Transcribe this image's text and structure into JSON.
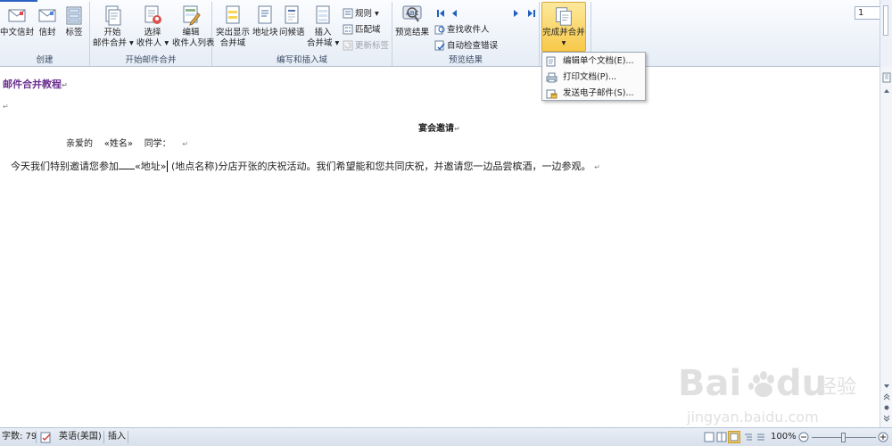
{
  "ribbon": {
    "groups": {
      "create": {
        "label": "创建",
        "buttons": [
          "中文信封",
          "信封",
          "标签"
        ]
      },
      "start_merge": {
        "label": "开始邮件合并",
        "start_line1": "开始",
        "start_line2": "邮件合并",
        "select_line1": "选择",
        "select_line2": "收件人",
        "edit_line1": "编辑",
        "edit_line2": "收件人列表"
      },
      "write_insert": {
        "label": "编写和插入域",
        "highlight_line1": "突出显示",
        "highlight_line2": "合并域",
        "address_block": "地址块",
        "greeting": "问候语",
        "insert_line1": "插入",
        "insert_line2": "合并域",
        "rules": "规则",
        "match_fields": "匹配域",
        "update_labels": "更新标签"
      },
      "preview": {
        "label": "预览结果",
        "preview_results": "预览结果",
        "record": "1",
        "find_recipient": "查找收件人",
        "auto_check": "自动检查错误"
      },
      "finish": {
        "label": "完成并合并"
      }
    }
  },
  "dropdown": {
    "items": [
      "编辑单个文档(E)...",
      "打印文档(P)...",
      "发送电子邮件(S)..."
    ]
  },
  "document": {
    "heading": "邮件合并教程",
    "title": "宴会邀请",
    "greeting_prefix": "亲爱的",
    "name_field": "«姓名»",
    "greeting_suffix": "同学：",
    "body_before": "今天我们特别邀请您参加",
    "address_field": "«地址»",
    "body_after": "(地点名称)分店开张的庆祝活动。我们希望能和您共同庆祝，并邀请您一边品尝槟酒，一边参观。"
  },
  "status": {
    "word_count": "字数: 79",
    "language": "英语(美国)",
    "mode": "插入",
    "zoom": "100%"
  },
  "watermark": {
    "brand": "Bai du 经验",
    "url": "jingyan.baidu.com"
  }
}
